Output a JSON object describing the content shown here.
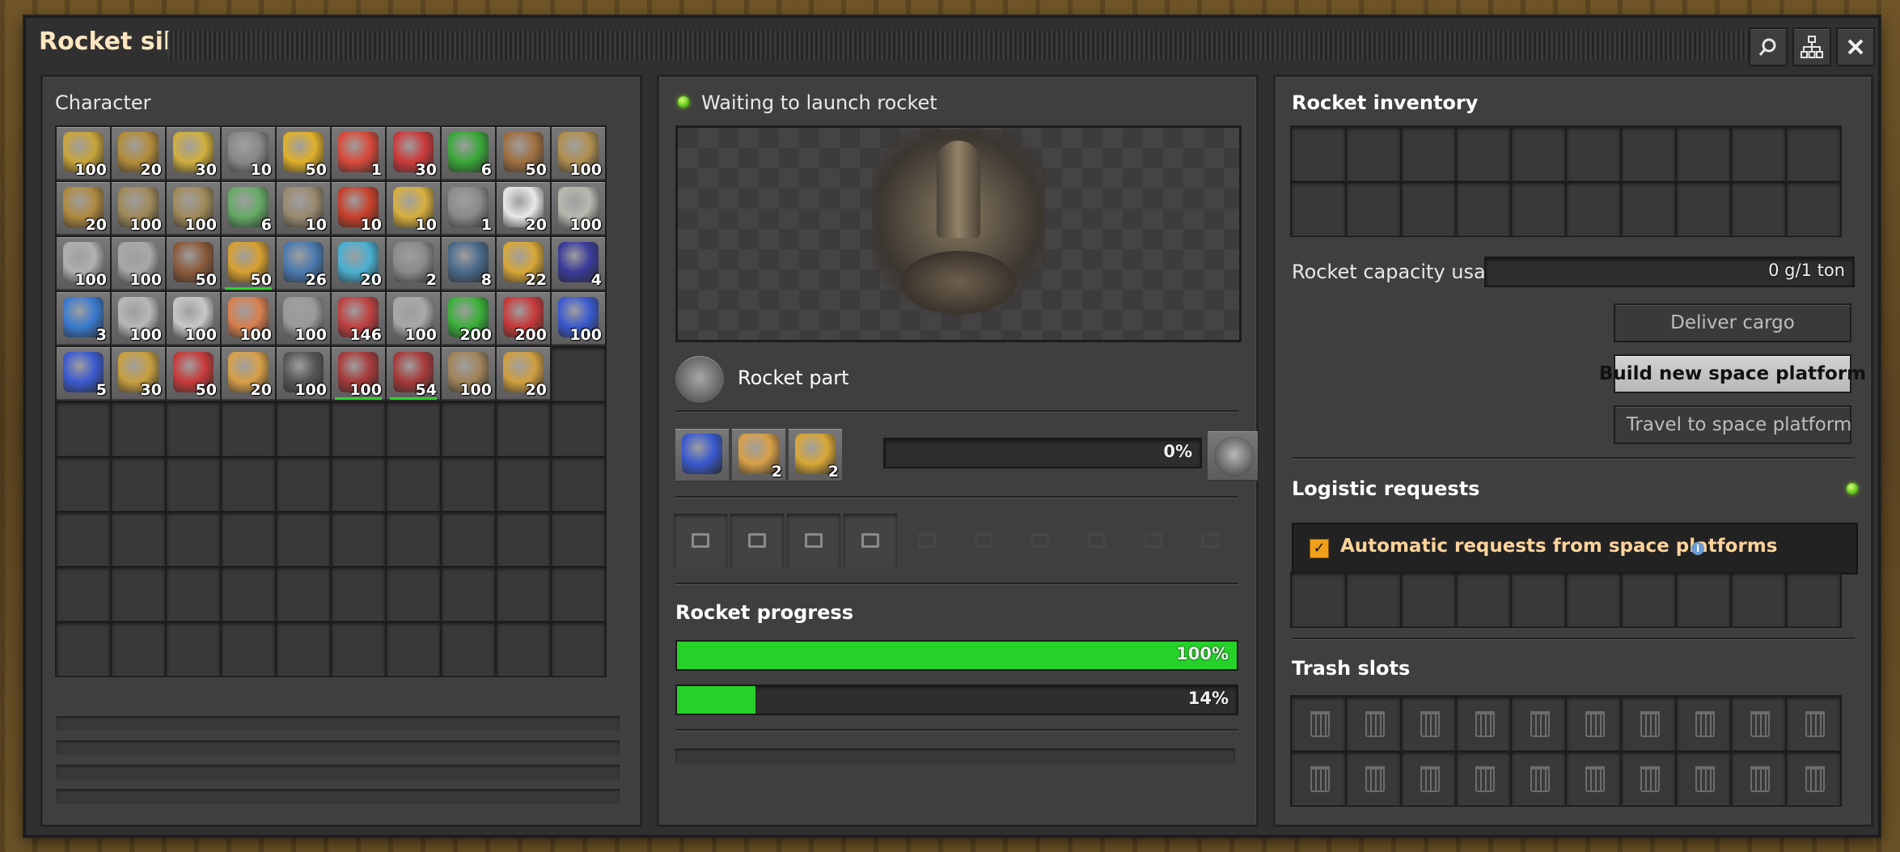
{
  "window": {
    "title": "Rocket silo",
    "buttons": [
      "search-icon",
      "network-icon",
      "close-icon"
    ]
  },
  "character": {
    "title": "Character",
    "items": [
      {
        "icon": "transport-belt-icon",
        "count": "100",
        "color": "#c9a53a"
      },
      {
        "icon": "underground-belt-icon",
        "count": "20",
        "color": "#b38c3a"
      },
      {
        "icon": "splitter-icon",
        "count": "30",
        "color": "#d0b040"
      },
      {
        "icon": "burner-inserter-icon",
        "count": "10",
        "color": "#888"
      },
      {
        "icon": "inserter-icon",
        "count": "50",
        "color": "#e0b02a"
      },
      {
        "icon": "long-handed-inserter-icon",
        "count": "1",
        "color": "#d94a3a"
      },
      {
        "icon": "fast-inserter-icon",
        "count": "30",
        "color": "#cc3a3a"
      },
      {
        "icon": "filter-inserter-icon",
        "count": "6",
        "color": "#3aa83a"
      },
      {
        "icon": "small-electric-pole-icon",
        "count": "50",
        "color": "#a07040"
      },
      {
        "icon": "pipe-to-ground-icon",
        "count": "100",
        "color": "#b09050"
      },
      {
        "icon": "pipe-icon",
        "count": "20",
        "color": "#b08a40"
      },
      {
        "icon": "rail-icon",
        "count": "100",
        "color": "#a08a5a"
      },
      {
        "icon": "rail-straight-icon",
        "count": "100",
        "color": "#a08a5a"
      },
      {
        "icon": "train-signal-icon",
        "count": "6",
        "color": "#6a6"
      },
      {
        "icon": "boiler-icon",
        "count": "10",
        "color": "#9a8a70"
      },
      {
        "icon": "fuel-tank-icon",
        "count": "10",
        "color": "#c8402a"
      },
      {
        "icon": "steam-engine-icon",
        "count": "10",
        "color": "#d8b040"
      },
      {
        "icon": "radar-icon",
        "count": "1",
        "color": "#8a8a8a"
      },
      {
        "icon": "lamp-icon",
        "count": "20",
        "color": "#e8e8e8"
      },
      {
        "icon": "stone-brick-icon",
        "count": "100",
        "color": "#b8b8b0"
      },
      {
        "icon": "concrete-icon",
        "count": "100",
        "color": "#b0b0b0"
      },
      {
        "icon": "refined-concrete-icon",
        "count": "100",
        "color": "#a8a8a8"
      },
      {
        "icon": "landfill-icon",
        "count": "50",
        "color": "#8a5a3a"
      },
      {
        "icon": "repair-pack-icon",
        "count": "50",
        "color": "#d8a030",
        "bar": true
      },
      {
        "icon": "solar-panel-icon",
        "count": "26",
        "color": "#4a7ab0"
      },
      {
        "icon": "accumulator-icon",
        "count": "20",
        "color": "#4ab0d0"
      },
      {
        "icon": "roboport-icon",
        "count": "2",
        "color": "#8a8a8a"
      },
      {
        "icon": "armor-icon",
        "count": "8",
        "color": "#4a6a8a"
      },
      {
        "icon": "robot-icon",
        "count": "22",
        "color": "#d8a838"
      },
      {
        "icon": "gear-icon",
        "count": "4",
        "color": "#3a3a9a"
      },
      {
        "icon": "chemical-plant-icon",
        "count": "3",
        "color": "#3a7ad0"
      },
      {
        "icon": "iron-plate-icon",
        "count": "100",
        "color": "#b8b8b8"
      },
      {
        "icon": "steel-plate-icon",
        "count": "100",
        "color": "#c8c8c8"
      },
      {
        "icon": "copper-plate-icon",
        "count": "100",
        "color": "#d88050"
      },
      {
        "icon": "iron-stick-icon",
        "count": "100",
        "color": "#9a9a9a"
      },
      {
        "icon": "engine-icon",
        "count": "146",
        "color": "#c04040"
      },
      {
        "icon": "iron-gear-icon",
        "count": "100",
        "color": "#a8a8a8"
      },
      {
        "icon": "electronic-circuit-icon",
        "count": "200",
        "color": "#3ab03a"
      },
      {
        "icon": "advanced-circuit-icon",
        "count": "200",
        "color": "#c83a3a"
      },
      {
        "icon": "processing-unit-icon",
        "count": "100",
        "color": "#3a5ad0"
      },
      {
        "icon": "processing-unit-b-icon",
        "count": "5",
        "color": "#3a5ad0"
      },
      {
        "icon": "copper-cable-icon",
        "count": "30",
        "color": "#c8a040"
      },
      {
        "icon": "rocket-fuel-icon",
        "count": "50",
        "color": "#c83a3a"
      },
      {
        "icon": "low-density-structure-icon",
        "count": "20",
        "color": "#d8a048"
      },
      {
        "icon": "coal-icon",
        "count": "100",
        "color": "#555"
      },
      {
        "icon": "rail-ramp-icon",
        "count": "100",
        "color": "#a83a3a",
        "bar": true
      },
      {
        "icon": "elevated-rail-icon",
        "count": "54",
        "color": "#a83a3a",
        "bar": true
      },
      {
        "icon": "wood-icon",
        "count": "100",
        "color": "#a0845a"
      },
      {
        "icon": "pump-icon",
        "count": "20",
        "color": "#d0a040"
      }
    ]
  },
  "silo": {
    "status": "Waiting to launch rocket",
    "recipe_name": "Rocket part",
    "ingredients": [
      {
        "icon": "processing-unit-icon",
        "count": "",
        "color": "#3a5ad0"
      },
      {
        "icon": "low-density-structure-icon",
        "count": "2",
        "color": "#d8a048"
      },
      {
        "icon": "rocket-fuel-icon",
        "count": "2",
        "color": "#d8a838"
      }
    ],
    "craft_progress": "0%",
    "craft_fraction": 0,
    "rocket_progress_label": "Rocket progress",
    "progress_1": "100%",
    "progress_1_fraction": 1.0,
    "progress_2": "14%",
    "progress_2_fraction": 0.14,
    "module_slots": 4
  },
  "rocket_inventory": {
    "title": "Rocket inventory",
    "capacity_label": "Rocket capacity usage",
    "capacity_value": "0 g/1 ton",
    "deliver_cargo": "Deliver cargo",
    "build_platform": "Build new space platform",
    "travel_platform": "Travel to space platform"
  },
  "logistics": {
    "title": "Logistic requests",
    "auto_requests": "Automatic requests from space platforms",
    "info_icon": "info-icon"
  },
  "trash": {
    "title": "Trash slots"
  },
  "colors": {
    "green": "#26d12a",
    "title": "#ffe6c0",
    "panel": "#403f40"
  }
}
